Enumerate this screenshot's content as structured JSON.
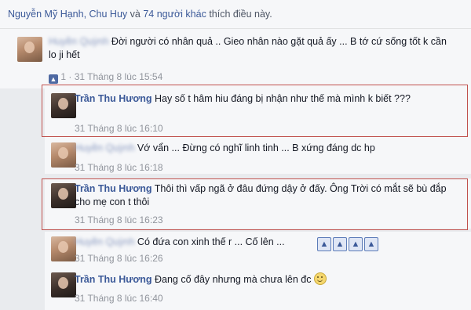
{
  "likes_bar": {
    "names": "Nguyễn Mỹ Hạnh, Chu Huy",
    "and_text": "và",
    "others_link": "74 người khác",
    "suffix": "thích điều này."
  },
  "comments": [
    {
      "author": "Huyền Quỳnh",
      "text": "Đời người có nhân quả .. Gieo nhân nào gặt quả ấy ... B tớ cứ sống tốt k cần lo ji hết",
      "like_count": "1",
      "timestamp": "31 Tháng 8 lúc 15:54"
    },
    {
      "author": "Trần Thu Hương",
      "text": "Hay số t hâm hiu đáng bị nhận như thế mà mình k biết ???",
      "timestamp": "31 Tháng 8 lúc 16:10"
    },
    {
      "author": "Huyền Quỳnh",
      "text": "Vớ vẩn ... Đừng có nghĩ linh tinh ... B xứng đáng dc hp",
      "timestamp": "31 Tháng 8 lúc 16:18"
    },
    {
      "author": "Trần Thu Hương",
      "text": "Thôi thì vấp ngã ở đâu đứng dậy ở đấy. Ông Trời có mắt sẽ bù đắp cho mẹ con t thôi",
      "timestamp": "31 Tháng 8 lúc 16:23"
    },
    {
      "author": "Huyền Quỳnh",
      "text": "Có đứa con xinh thế r ... Cố lên ...",
      "timestamp": "31 Tháng 8 lúc 16:26"
    },
    {
      "author": "Trần Thu Hương",
      "text": "Đang cố đây nhưng mà chưa lên đc",
      "timestamp": "31 Tháng 8 lúc 16:40"
    }
  ],
  "icons": {
    "like": "thumbs-up-icon",
    "smile": "smile-emoji-icon"
  },
  "colors": {
    "link": "#3b5998",
    "highlight_border": "#c0504d",
    "meta": "#90949c"
  }
}
